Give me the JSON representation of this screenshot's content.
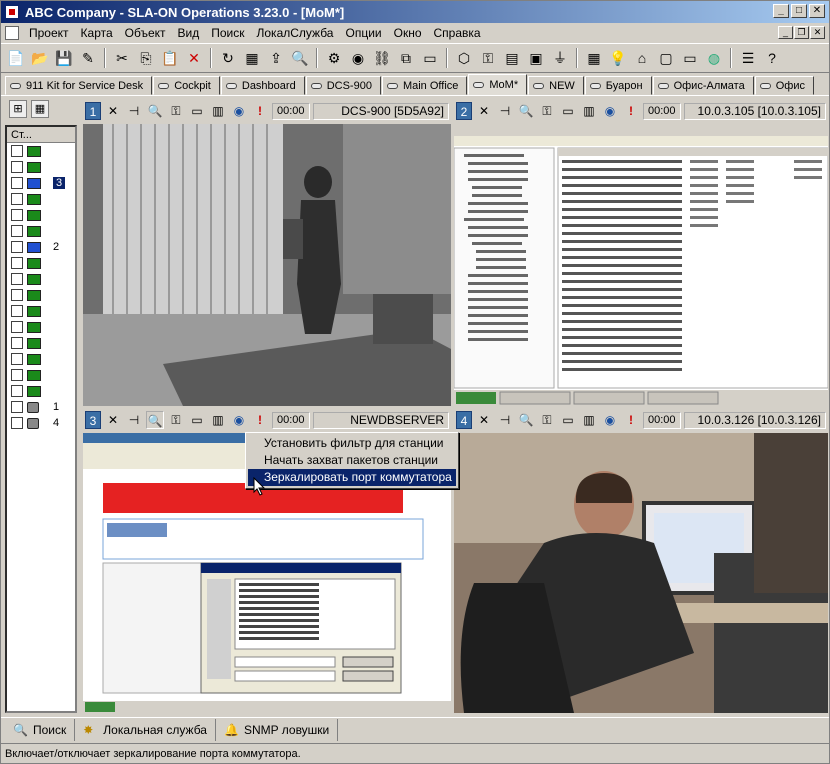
{
  "window": {
    "title": "ABC Company - SLA-ON Operations 3.23.0 - [MoM*]"
  },
  "menu": [
    "Проект",
    "Карта",
    "Объект",
    "Вид",
    "Поиск",
    "ЛокалСлужба",
    "Опции",
    "Окно",
    "Справка"
  ],
  "tabs": [
    "911 Kit for Service Desk",
    "Cockpit",
    "Dashboard",
    "DCS-900",
    "Main Office",
    "MoM*",
    "NEW",
    "Буарон",
    "Офис-Алмата",
    "Офис"
  ],
  "active_tab": "MoM*",
  "left_pane": {
    "header": "Ст...",
    "rows": [
      {
        "icon": "green",
        "num": ""
      },
      {
        "icon": "green",
        "num": ""
      },
      {
        "icon": "blue",
        "num": "3",
        "selected": true
      },
      {
        "icon": "green",
        "num": ""
      },
      {
        "icon": "green",
        "num": ""
      },
      {
        "icon": "green",
        "num": ""
      },
      {
        "icon": "blue",
        "num": "2"
      },
      {
        "icon": "green",
        "num": ""
      },
      {
        "icon": "green",
        "num": ""
      },
      {
        "icon": "green",
        "num": ""
      },
      {
        "icon": "green",
        "num": ""
      },
      {
        "icon": "green",
        "num": ""
      },
      {
        "icon": "green",
        "num": ""
      },
      {
        "icon": "green",
        "num": ""
      },
      {
        "icon": "green",
        "num": ""
      },
      {
        "icon": "green",
        "num": ""
      },
      {
        "icon": "cam",
        "num": "1"
      },
      {
        "icon": "cam",
        "num": "4"
      }
    ]
  },
  "panels": [
    {
      "num": "1",
      "time": "00:00",
      "name": "DCS-900 [5D5A92]"
    },
    {
      "num": "2",
      "time": "00:00",
      "name": "10.0.3.105 [10.0.3.105]"
    },
    {
      "num": "3",
      "time": "00:00",
      "name": "NEWDBSERVER"
    },
    {
      "num": "4",
      "time": "00:00",
      "name": "10.0.3.126 [10.0.3.126]"
    }
  ],
  "context_menu": {
    "items": [
      "Установить фильтр для станции",
      "Начать захват пакетов станции",
      "Зеркалировать порт коммутатора"
    ],
    "highlighted": 2
  },
  "bottom_buttons": [
    "Поиск",
    "Локальная служба",
    "SNMP ловушки"
  ],
  "status": "Включает/отключает зеркалирование порта коммутатора.",
  "colors": {
    "title_start": "#0a246a",
    "title_end": "#a6caf0",
    "selection": "#0a246a",
    "panel_num": "#3a6ea5"
  }
}
